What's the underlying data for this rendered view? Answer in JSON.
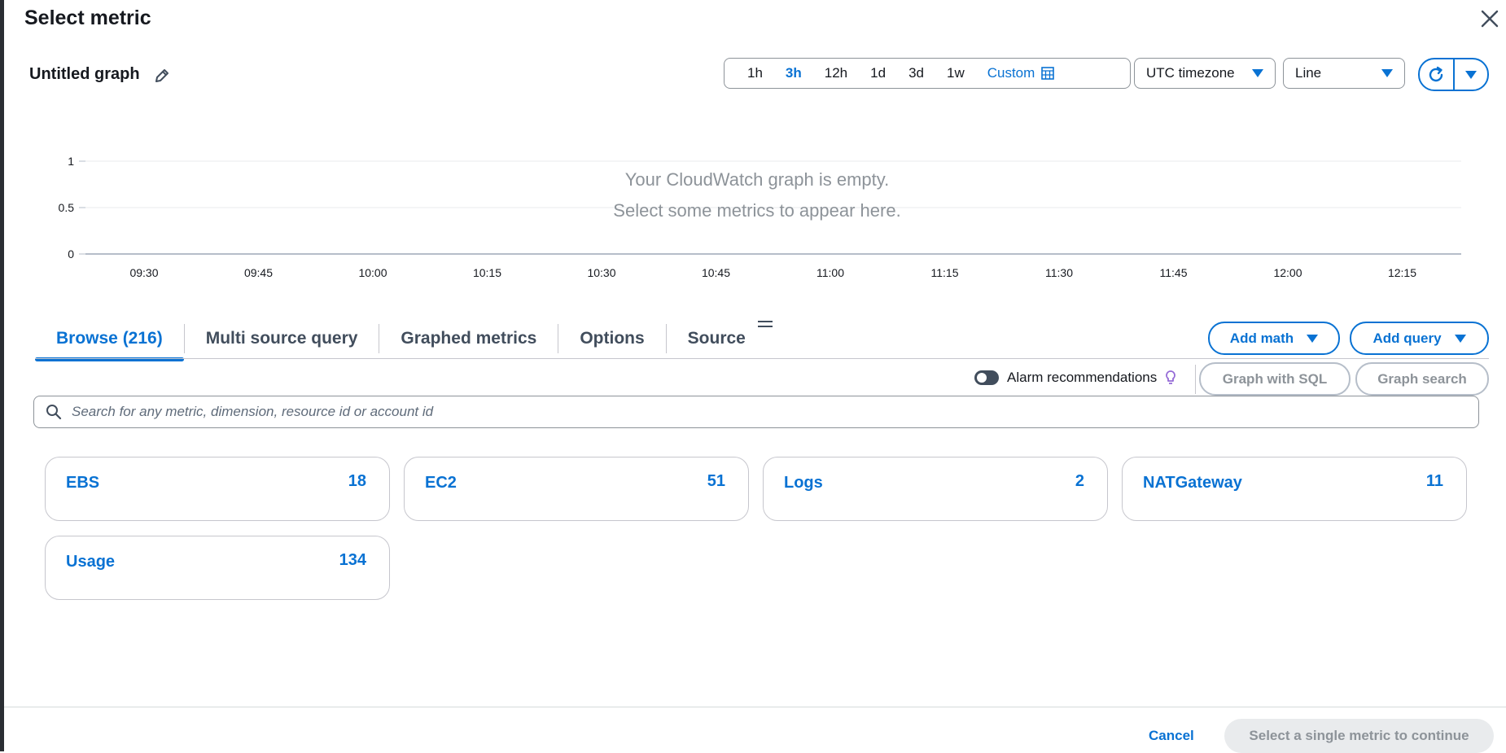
{
  "dialog": {
    "title": "Select metric"
  },
  "graph": {
    "title": "Untitled graph"
  },
  "time_range": {
    "options": [
      "1h",
      "3h",
      "12h",
      "1d",
      "3d",
      "1w"
    ],
    "active": "3h",
    "custom_label": "Custom"
  },
  "timezone": {
    "selected": "UTC timezone"
  },
  "chart_type": {
    "selected": "Line"
  },
  "chart_data": {
    "type": "line",
    "series": [],
    "x_ticks": [
      "09:30",
      "09:45",
      "10:00",
      "10:15",
      "10:30",
      "10:45",
      "11:00",
      "11:15",
      "11:30",
      "11:45",
      "12:00",
      "12:15"
    ],
    "y_ticks": [
      "1",
      "0.5",
      "0"
    ],
    "ylim": [
      0,
      1
    ],
    "grid": true,
    "empty_message_line1": "Your CloudWatch graph is empty.",
    "empty_message_line2": "Select some metrics to appear here."
  },
  "tabs": [
    {
      "label": "Browse (216)",
      "active": true
    },
    {
      "label": "Multi source query",
      "active": false
    },
    {
      "label": "Graphed metrics",
      "active": false
    },
    {
      "label": "Options",
      "active": false
    },
    {
      "label": "Source",
      "active": false
    }
  ],
  "actions": {
    "add_math": "Add math",
    "add_query": "Add query",
    "alarm_recommendations": "Alarm recommendations",
    "graph_with_sql": "Graph with SQL",
    "graph_search": "Graph search"
  },
  "search": {
    "placeholder": "Search for any metric, dimension, resource id or account id",
    "value": ""
  },
  "namespaces": [
    {
      "name": "EBS",
      "count": "18"
    },
    {
      "name": "EC2",
      "count": "51"
    },
    {
      "name": "Logs",
      "count": "2"
    },
    {
      "name": "NATGateway",
      "count": "11"
    },
    {
      "name": "Usage",
      "count": "134"
    }
  ],
  "footer": {
    "cancel": "Cancel",
    "continue": "Select a single metric to continue"
  },
  "colors": {
    "accent": "#0972d3",
    "text": "#16191f",
    "muted": "#8d9399"
  }
}
